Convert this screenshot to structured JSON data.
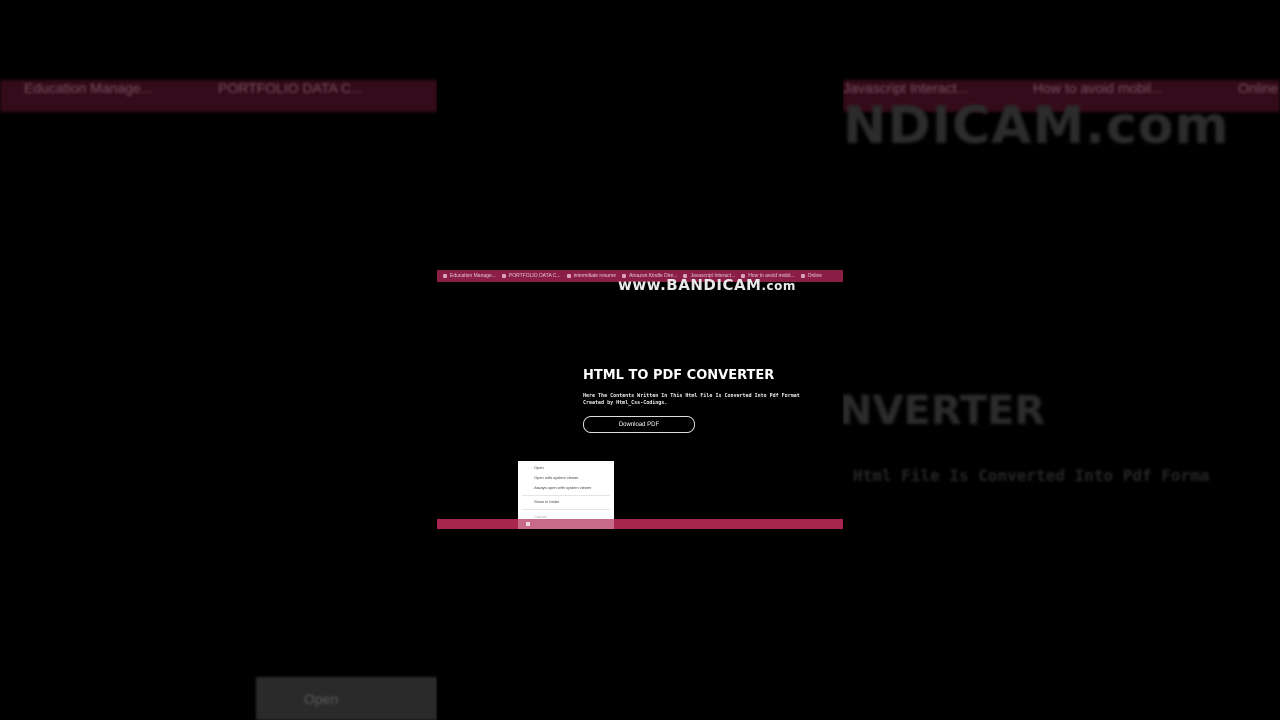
{
  "background": {
    "tabs": [
      "Education Manage...",
      "PORTFOLIO DATA C...",
      "Javascript Interact...",
      "How to avoid mobil...",
      "Online"
    ],
    "watermark": "NDICAM.com",
    "title_fragment": "NVERTER",
    "subtitle_fragment": "Html File Is Converted Into Pdf Forma",
    "open_button": "Open"
  },
  "browser": {
    "tabs": [
      "Education Manage...",
      "PORTFOLIO DATA C...",
      "intermitiate resume",
      "Amazon Kindle Dire...",
      "Javascript Interact...",
      "How to avoid mobil...",
      "Online"
    ]
  },
  "watermark": {
    "text": "www.BANDICAM",
    "suffix": ".com"
  },
  "page": {
    "title": "HTML TO PDF CONVERTER",
    "description_line1": "Here The Contents Written In This Html File Is Converted Into Pdf Format",
    "description_line2": "Created by Html_Css-Codings.",
    "download_button": "Download PDF"
  },
  "context_menu": {
    "items": [
      "Open",
      "Open with system viewer",
      "Always open with system viewer",
      "Show in folder",
      "Cancel"
    ]
  },
  "colors": {
    "tabbar": "#8a1e45",
    "downloadbar": "#a8264e",
    "page_bg": "#000000",
    "text": "#ffffff"
  }
}
